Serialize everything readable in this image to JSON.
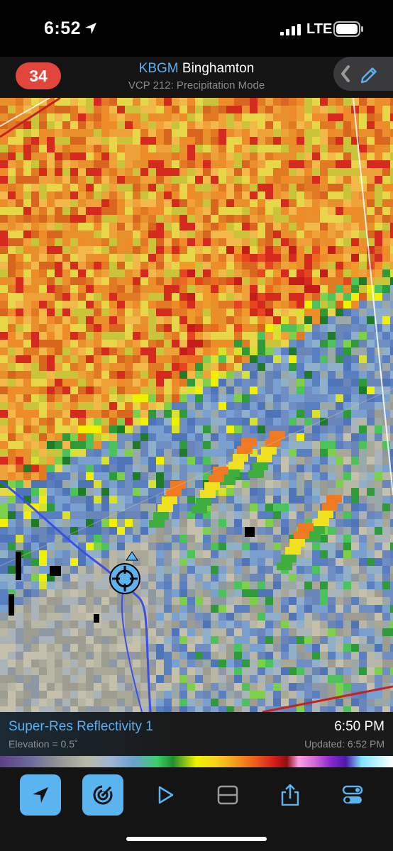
{
  "status_bar": {
    "time": "6:52",
    "carrier": "LTE",
    "icons": [
      "location-arrow-icon",
      "signal-bars-icon",
      "battery-icon"
    ]
  },
  "header": {
    "badge_count": "34",
    "station_code": "KBGM",
    "station_name": "Binghamton",
    "subtitle": "VCP 212: Precipitation Mode",
    "icons": [
      "chevron-left-icon",
      "pencil-icon"
    ]
  },
  "info_panel": {
    "product": "Super-Res Reflectivity 1",
    "elevation": "Elevation = 0.5˚",
    "scan_time": "6:50 PM",
    "updated": "Updated: 6:52 PM"
  },
  "toolbar": {
    "items": [
      {
        "icon": "location-arrow-icon",
        "active": true
      },
      {
        "icon": "radar-icon",
        "active": true
      },
      {
        "icon": "play-icon",
        "active": false
      },
      {
        "icon": "layout-icon",
        "active": false
      },
      {
        "icon": "share-icon",
        "active": false
      },
      {
        "icon": "settings-toggle-icon",
        "active": false
      }
    ]
  },
  "colors": {
    "accent": "#5ab4f0",
    "badge": "#e2453c",
    "header_bg": "#141414"
  }
}
